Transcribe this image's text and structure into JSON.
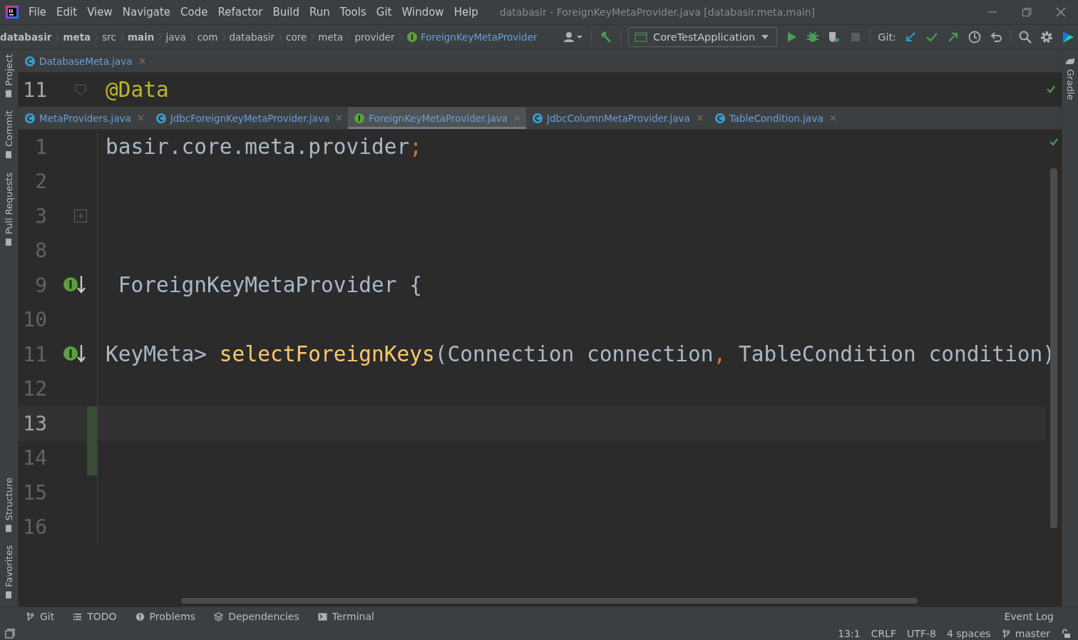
{
  "menu": [
    "File",
    "Edit",
    "View",
    "Navigate",
    "Code",
    "Refactor",
    "Build",
    "Run",
    "Tools",
    "Git",
    "Window",
    "Help"
  ],
  "window": {
    "title": "databasir - ForeignKeyMetaProvider.java [databasir.meta.main]"
  },
  "breadcrumbs": [
    {
      "label": "databasir",
      "bold": true
    },
    {
      "label": "meta",
      "bold": true
    },
    {
      "label": "src",
      "bold": false
    },
    {
      "label": "main",
      "bold": true
    },
    {
      "label": "java",
      "bold": false
    },
    {
      "label": "com",
      "bold": false
    },
    {
      "label": "databasir",
      "bold": false
    },
    {
      "label": "core",
      "bold": false
    },
    {
      "label": "meta",
      "bold": false
    },
    {
      "label": "provider",
      "bold": false
    },
    {
      "label": "ForeignKeyMetaProvider",
      "bold": false,
      "kind": "interface"
    }
  ],
  "toolbar": {
    "run_config": "CoreTestApplication",
    "git_label": "Git:"
  },
  "left_tools_top": [
    {
      "label": "Project"
    },
    {
      "label": "Commit"
    },
    {
      "label": "Pull Requests"
    }
  ],
  "left_tools_bottom": [
    {
      "label": "Structure"
    },
    {
      "label": "Favorites"
    }
  ],
  "right_tools": [
    {
      "label": "Gradle"
    }
  ],
  "top_split": {
    "tabs": [
      {
        "label": "DatabaseMeta.java",
        "kind": "class",
        "selected": false
      }
    ],
    "line_number": "11",
    "code": [
      {
        "text": "@Data",
        "kind": "annotation"
      }
    ]
  },
  "tabs": [
    {
      "label": "MetaProviders.java",
      "kind": "class",
      "selected": false
    },
    {
      "label": "JdbcForeignKeyMetaProvider.java",
      "kind": "class",
      "selected": false
    },
    {
      "label": "ForeignKeyMetaProvider.java",
      "kind": "interface",
      "selected": true
    },
    {
      "label": "JdbcColumnMetaProvider.java",
      "kind": "class",
      "selected": false
    },
    {
      "label": "TableCondition.java",
      "kind": "class",
      "selected": false
    }
  ],
  "lines": [
    {
      "number": "1",
      "current": false,
      "changed": false,
      "implemented": false,
      "fold": false,
      "code": [
        {
          "text": "basir.core.meta.provider",
          "kind": "plain"
        },
        {
          "text": ";",
          "kind": "keyword"
        }
      ]
    },
    {
      "number": "2",
      "current": false,
      "changed": false,
      "implemented": false,
      "fold": false
    },
    {
      "number": "3",
      "current": false,
      "changed": false,
      "implemented": false,
      "fold": true
    },
    {
      "number": "8",
      "current": false,
      "changed": false,
      "implemented": false,
      "fold": false
    },
    {
      "number": "9",
      "current": false,
      "changed": false,
      "implemented": true,
      "fold": false,
      "code": [
        {
          "text": " ForeignKeyMetaProvider {",
          "kind": "plain"
        }
      ]
    },
    {
      "number": "10",
      "current": false,
      "changed": false,
      "implemented": false,
      "fold": false
    },
    {
      "number": "11",
      "current": false,
      "changed": false,
      "implemented": true,
      "fold": false,
      "code": [
        {
          "text": "KeyMeta> ",
          "kind": "plain"
        },
        {
          "text": "selectForeignKeys",
          "kind": "method"
        },
        {
          "text": "(Connection connection",
          "kind": "plain"
        },
        {
          "text": ",",
          "kind": "keyword"
        },
        {
          "text": " TableCondition condition)",
          "kind": "plain"
        }
      ]
    },
    {
      "number": "12",
      "current": false,
      "changed": false,
      "implemented": false,
      "fold": false
    },
    {
      "number": "13",
      "current": true,
      "changed": true,
      "implemented": false,
      "fold": false
    },
    {
      "number": "14",
      "current": false,
      "changed": true,
      "implemented": false,
      "fold": false
    },
    {
      "number": "15",
      "current": false,
      "changed": false,
      "implemented": false,
      "fold": false
    },
    {
      "number": "16",
      "current": false,
      "changed": false,
      "implemented": false,
      "fold": false
    }
  ],
  "bottom_tools": [
    {
      "label": "Git",
      "kind": "branch"
    },
    {
      "label": "TODO",
      "kind": "list"
    },
    {
      "label": "Problems",
      "kind": "alert"
    },
    {
      "label": "Dependencies",
      "kind": "layers"
    },
    {
      "label": "Terminal",
      "kind": "terminal"
    }
  ],
  "event_log": "Event Log",
  "status": [
    "13:1",
    "CRLF",
    "UTF-8",
    "4 spaces"
  ],
  "branch": "master"
}
